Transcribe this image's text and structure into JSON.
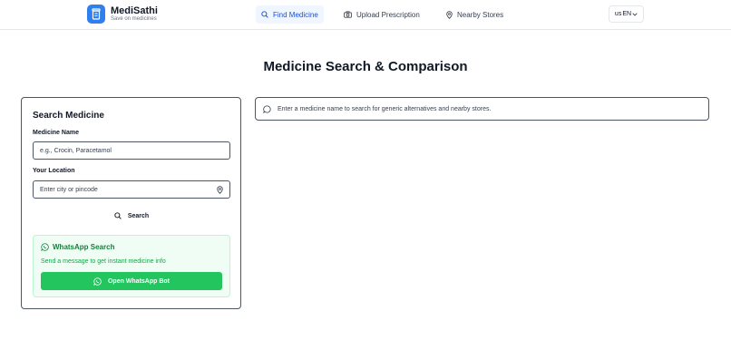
{
  "brand": {
    "name": "MediSathi",
    "tagline": "Save on medicines"
  },
  "nav": [
    {
      "label": "Find Medicine",
      "icon": "search-icon",
      "active": true
    },
    {
      "label": "Upload Prescription",
      "icon": "camera-icon"
    },
    {
      "label": "Nearby Stores",
      "icon": "map-pin-icon"
    }
  ],
  "language": {
    "flag": "us",
    "code": "EN"
  },
  "page_title": "Medicine Search & Comparison",
  "search_panel": {
    "title": "Search Medicine",
    "medicine_label": "Medicine Name",
    "medicine_placeholder": "e.g., Crocin, Paracetamol",
    "location_label": "Your Location",
    "location_placeholder": "Enter city or pincode",
    "search_label": "Search"
  },
  "whatsapp": {
    "title": "WhatsApp Search",
    "description": "Send a message to get instant medicine info",
    "button_label": "Open WhatsApp Bot"
  },
  "results": {
    "message": "Enter a medicine name to search for generic alternatives and nearby stores."
  },
  "colors": {
    "brand_blue": "#2f80ed",
    "whatsapp_green": "#22c55e",
    "nav_active": "#1d4ed8"
  }
}
